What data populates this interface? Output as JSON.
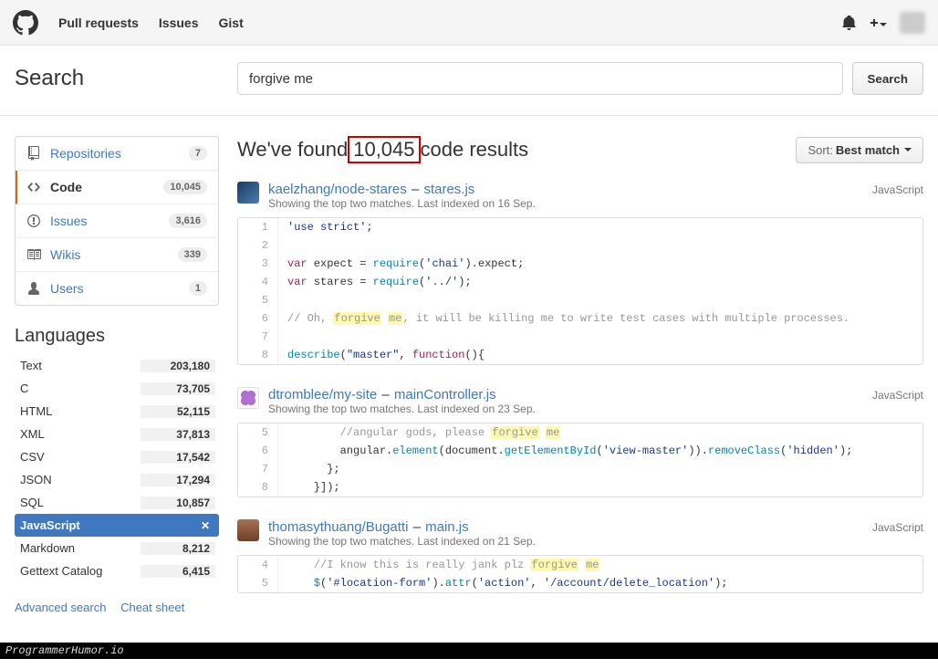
{
  "topnav": {
    "pull": "Pull requests",
    "issues": "Issues",
    "gist": "Gist"
  },
  "search": {
    "title": "Search",
    "value": "forgive me",
    "button": "Search"
  },
  "nav": {
    "repos": {
      "label": "Repositories",
      "count": "7"
    },
    "code": {
      "label": "Code",
      "count": "10,045"
    },
    "issues": {
      "label": "Issues",
      "count": "3,616"
    },
    "wikis": {
      "label": "Wikis",
      "count": "339"
    },
    "users": {
      "label": "Users",
      "count": "1"
    }
  },
  "languages_title": "Languages",
  "languages": {
    "text": {
      "label": "Text",
      "count": "203,180"
    },
    "c": {
      "label": "C",
      "count": "73,705"
    },
    "html": {
      "label": "HTML",
      "count": "52,115"
    },
    "xml": {
      "label": "XML",
      "count": "37,813"
    },
    "csv": {
      "label": "CSV",
      "count": "17,542"
    },
    "json": {
      "label": "JSON",
      "count": "17,294"
    },
    "sql": {
      "label": "SQL",
      "count": "10,857"
    },
    "js": {
      "label": "JavaScript",
      "count": ""
    },
    "md": {
      "label": "Markdown",
      "count": "8,212"
    },
    "get": {
      "label": "Gettext Catalog",
      "count": "6,415"
    }
  },
  "sidelinks": {
    "adv": "Advanced search",
    "cheat": "Cheat sheet"
  },
  "results_header": {
    "pre": "We've found ",
    "number": "10,045",
    "post": " code results"
  },
  "sort": {
    "label": "Sort:",
    "value": "Best match"
  },
  "results": {
    "r1": {
      "repo": "kaelzhang/node-stares",
      "file": "stares.js",
      "sub": "Showing the top two matches. Last indexed on 16 Sep.",
      "lang": "JavaScript"
    },
    "r2": {
      "repo": "dtromblee/my-site",
      "file": "mainController.js",
      "sub": "Showing the top two matches. Last indexed on 23 Sep.",
      "lang": "JavaScript"
    },
    "r3": {
      "repo": "thomasythuang/Bugatti",
      "file": "main.js",
      "sub": "Showing the top two matches. Last indexed on 21 Sep.",
      "lang": "JavaScript"
    }
  },
  "watermark": "ProgrammerHumor.io"
}
